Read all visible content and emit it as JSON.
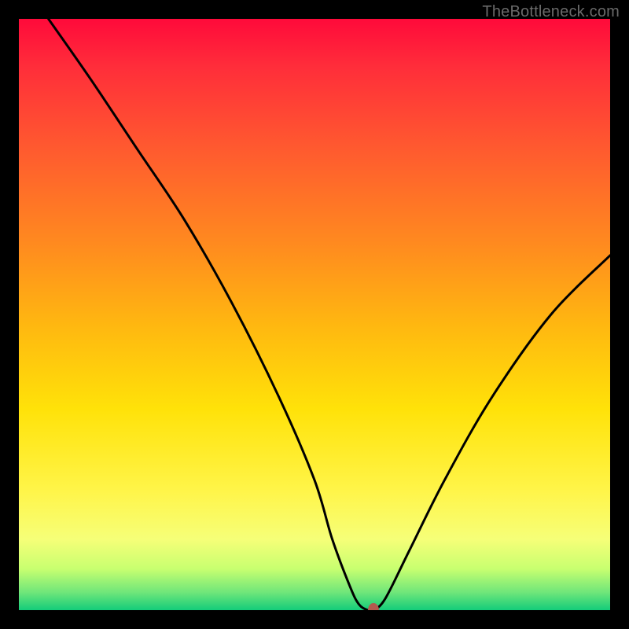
{
  "watermark": "TheBottleneck.com",
  "chart_data": {
    "type": "line",
    "title": "",
    "xlabel": "",
    "ylabel": "",
    "xlim": [
      0,
      100
    ],
    "ylim": [
      0,
      100
    ],
    "grid": false,
    "series": [
      {
        "name": "bottleneck-curve",
        "x": [
          5,
          12,
          20,
          28,
          36,
          44,
          50,
          53,
          56,
          57.5,
          59,
          60,
          62,
          66,
          72,
          80,
          90,
          100
        ],
        "y": [
          100,
          90,
          78,
          66,
          52,
          36,
          22,
          12,
          4,
          1,
          0,
          0,
          2,
          10,
          22,
          36,
          50,
          60
        ]
      }
    ],
    "annotations": [
      {
        "name": "curve-minimum-marker",
        "x": 60,
        "y": 0
      }
    ],
    "background": {
      "type": "vertical-gradient",
      "stops": [
        {
          "pos": 0,
          "color": "#ff0a3a"
        },
        {
          "pos": 22,
          "color": "#ff5a2f"
        },
        {
          "pos": 52,
          "color": "#ffb810"
        },
        {
          "pos": 80,
          "color": "#fff54a"
        },
        {
          "pos": 97,
          "color": "#6fe67a"
        },
        {
          "pos": 100,
          "color": "#14cc7a"
        }
      ]
    }
  },
  "colors": {
    "frame": "#000000",
    "curve": "#000000",
    "marker": "#b45a4e",
    "watermark": "#6a6a6a"
  }
}
